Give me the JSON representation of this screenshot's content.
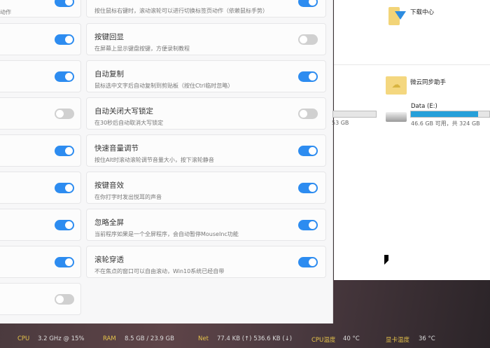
{
  "settings": {
    "left_partial_desc": "动作",
    "left_toggles": [
      true,
      true,
      true,
      false,
      true,
      true,
      true,
      true,
      false
    ],
    "right_cards": [
      {
        "title": "",
        "desc": "按住鼠标右键时，滚动滚轮可以进行切换标签页动作（依赖鼠标手势）",
        "on": true
      },
      {
        "title": "按键回显",
        "desc": "在屏幕上显示键盘按键，方便录制教程",
        "on": false
      },
      {
        "title": "自动复制",
        "desc": "鼠标选中文字后自动复制到剪贴板（按住Ctrl临时忽略）",
        "on": true
      },
      {
        "title": "自动关闭大写锁定",
        "desc": "在30秒后自动取消大写锁定",
        "on": false
      },
      {
        "title": "快速音量调节",
        "desc": "按住Alt时滚动滚轮调节音量大小，按下滚轮静音",
        "on": true
      },
      {
        "title": "按键音效",
        "desc": "在你打字时发出悦耳的声音",
        "on": true
      },
      {
        "title": "忽略全屏",
        "desc": "当前程序如果是一个全屏程序，会自动暂停MouseInc功能",
        "on": true
      },
      {
        "title": "滚轮穿透",
        "desc": "不在焦点的窗口可以自由滚动，Win10系统已经自带",
        "on": true
      }
    ]
  },
  "explorer": {
    "folder1": "下载中心",
    "folder2": "微云同步助手",
    "drive_name": "Data (E:)",
    "drive_info": "46.6 GB 可用，共 324 GB",
    "drive_used_fraction": 0.86,
    "partial_drive_info": "53 GB",
    "partial_drive_used_fraction": 0.0
  },
  "taskbar": {
    "cpu_label": "CPU",
    "cpu_value": "3.2 GHz @ 15%",
    "ram_label": "RAM",
    "ram_value": "8.5 GB / 23.9 GB",
    "net_label": "Net",
    "net_value": "77.4 KB (↑)  536.6 KB (↓)",
    "cputemp_label": "CPU温度",
    "cputemp_value": "40 °C",
    "gputemp_label": "显卡温度",
    "gputemp_value": "36 °C"
  }
}
